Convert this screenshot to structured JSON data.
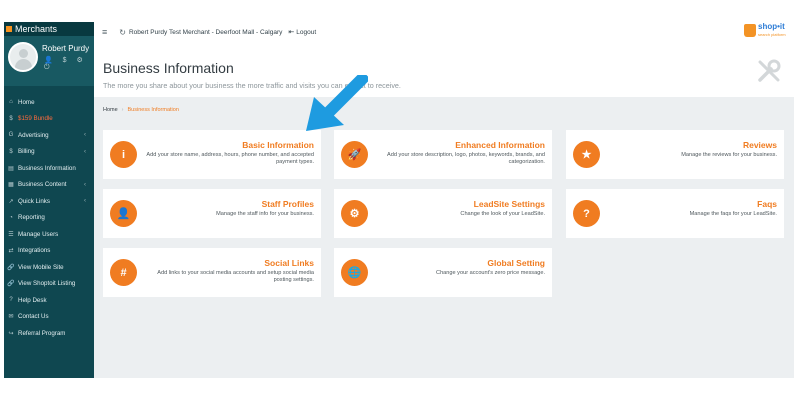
{
  "sidebar": {
    "brand": "Merchants",
    "profile_name": "Robert Purdy",
    "profile_icons": "👤 $ ⚙ ⏻",
    "items": [
      {
        "icon": "⌂",
        "label": "Home",
        "caret": ""
      },
      {
        "icon": "$",
        "label": "$159 Bundle",
        "caret": ""
      },
      {
        "icon": "G",
        "label": "Advertising",
        "caret": "‹"
      },
      {
        "icon": "$",
        "label": "Billing",
        "caret": "‹"
      },
      {
        "icon": "▤",
        "label": "Business Information",
        "caret": ""
      },
      {
        "icon": "▦",
        "label": "Business Content",
        "caret": "‹"
      },
      {
        "icon": "↗",
        "label": "Quick Links",
        "caret": "‹"
      },
      {
        "icon": "◔",
        "label": "Reporting",
        "caret": ""
      },
      {
        "icon": "☰",
        "label": "Manage Users",
        "caret": ""
      },
      {
        "icon": "⇄",
        "label": "Integrations",
        "caret": ""
      },
      {
        "icon": "🔗",
        "label": "View Mobile Site",
        "caret": ""
      },
      {
        "icon": "🔗",
        "label": "View Shoptoit Listing",
        "caret": ""
      },
      {
        "icon": "?",
        "label": "Help Desk",
        "caret": ""
      },
      {
        "icon": "✉",
        "label": "Contact Us",
        "caret": ""
      },
      {
        "icon": "↪",
        "label": "Referral Program",
        "caret": ""
      }
    ]
  },
  "topbar": {
    "merchant": "Robert Purdy Test Merchant - Deerfoot Mall - Calgary",
    "logout": "Logout",
    "logo_word": "shop•it",
    "logo_sub": "search platform"
  },
  "header": {
    "title": "Business Information",
    "subtitle": "The more you share about your business the more traffic and visits you can expect to receive."
  },
  "breadcrumb": {
    "home": "Home",
    "sep": "›",
    "current": "Business Information"
  },
  "cards": [
    {
      "icon": "i",
      "title": "Basic Information",
      "desc": "Add your store name, address, hours, phone number, and accepted payment types."
    },
    {
      "icon": "🚀",
      "title": "Enhanced Information",
      "desc": "Add your store description, logo, photos, keywords, brands, and categorization."
    },
    {
      "icon": "★",
      "title": "Reviews",
      "desc": "Manage the reviews for your business."
    },
    {
      "icon": "👤",
      "title": "Staff Profiles",
      "desc": "Manage the staff info for your business."
    },
    {
      "icon": "⚙",
      "title": "LeadSite Settings",
      "desc": "Change the look of your LeadSite."
    },
    {
      "icon": "?",
      "title": "Faqs",
      "desc": "Manage the faqs for your LeadSite."
    },
    {
      "icon": "#",
      "title": "Social Links",
      "desc": "Add links to your social media accounts and setup social media posting settings."
    },
    {
      "icon": "🌐",
      "title": "Global Setting",
      "desc": "Change your account's zero price message."
    }
  ],
  "colors": {
    "accent": "#f07c21",
    "sidebar": "#0f4750",
    "arrow": "#1e9be0"
  }
}
